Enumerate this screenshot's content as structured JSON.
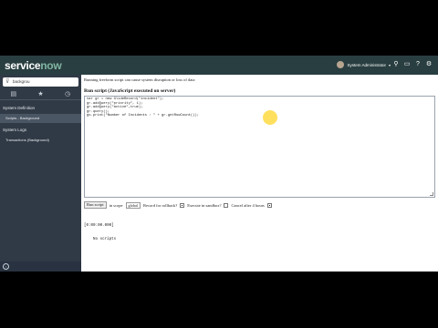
{
  "brand": {
    "service": "service",
    "now": "now"
  },
  "user": {
    "name": "System Administrator"
  },
  "sidebar": {
    "filter_value": "backgrou",
    "sections": [
      {
        "heading": "System Definition",
        "items": [
          {
            "label": "Scripts - Background",
            "selected": true
          }
        ]
      },
      {
        "heading": "System Logs",
        "items": [
          {
            "label": "Transactions (Background)",
            "selected": false
          }
        ]
      }
    ]
  },
  "main": {
    "warning": "Running freeform script can cause system disruption or loss of data",
    "section_title": "Run script (JavaScript executed on server)",
    "code_lines": [
      "var gr = new GlideRecord(\"incident\");",
      "gr.addQuery(\"priority\", 1);",
      "gr.addQuery(\"active\",true);",
      "gr.query();",
      "gs.print(\"Number of Incidents : \" + gr.getRowCount());"
    ],
    "run_button": "Run script",
    "in_scope_label": "in scope",
    "scope_value": "global",
    "rollback_label": "Record for rollback?",
    "sandbox_label": "Execute in sandbox?",
    "cancel_label": "Cancel after 4 hours",
    "output_lines": [
      "[0:00:00.000]",
      "    No scripts"
    ]
  }
}
